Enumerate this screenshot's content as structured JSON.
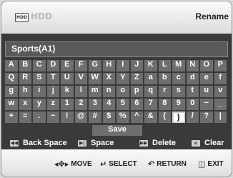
{
  "header": {
    "device_icon_text": "HDD",
    "device_label": "HDD",
    "mode_title": "Rename"
  },
  "name_field": {
    "value": "Sports(A1)"
  },
  "keyboard": {
    "rows": [
      [
        "A",
        "B",
        "C",
        "D",
        "E",
        "F",
        "G",
        "H",
        "I",
        "J",
        "K",
        "L",
        "M",
        "N",
        "O",
        "P"
      ],
      [
        "Q",
        "R",
        "S",
        "T",
        "U",
        "V",
        "W",
        "X",
        "Y",
        "Z",
        "a",
        "b",
        "c",
        "d",
        "e",
        "f"
      ],
      [
        "g",
        "h",
        "i",
        "j",
        "k",
        "l",
        "m",
        "n",
        "o",
        "p",
        "q",
        "r",
        "s",
        "t",
        "u",
        "v"
      ],
      [
        "w",
        "x",
        "y",
        "z",
        "1",
        "2",
        "3",
        "4",
        "5",
        "6",
        "7",
        "8",
        "9",
        "0",
        "−",
        "_"
      ],
      [
        "+",
        "=",
        ".",
        "~",
        "!",
        "@",
        "#",
        "$",
        "%",
        "^",
        "&",
        "(",
        ")",
        "/",
        "?",
        "|"
      ]
    ],
    "selected_key": ")",
    "save_label": "Save"
  },
  "functions": {
    "back_space": "Back Space",
    "space": "Space",
    "delete": "Delete",
    "clear": "Clear"
  },
  "navigation": {
    "move": "MOVE",
    "select": "SELECT",
    "return": "RETURN",
    "exit": "EXIT"
  }
}
